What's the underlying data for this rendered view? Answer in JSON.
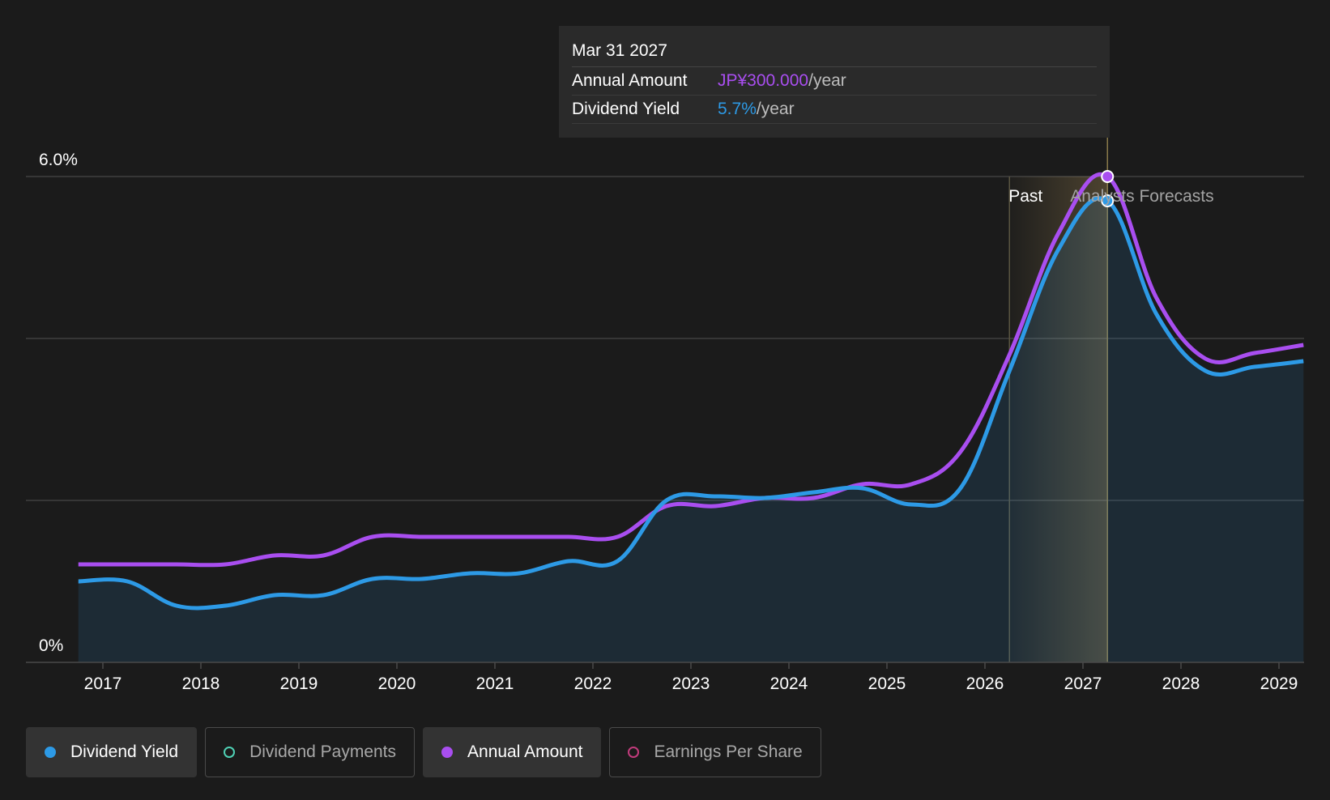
{
  "colors": {
    "background": "#1b1b1b",
    "dividend_yield": "#2d9ae6",
    "annual_amount": "#a94ef0",
    "dividend_payments": "#4fd1b5",
    "earnings_per_share": "#c23b7c",
    "gridline": "#3f3f3f"
  },
  "tooltip": {
    "date": "Mar 31 2027",
    "rows": [
      {
        "label": "Annual Amount",
        "value": "JP¥300.000",
        "unit": "/year",
        "color": "#a94ef0"
      },
      {
        "label": "Dividend Yield",
        "value": "5.7%",
        "unit": "/year",
        "color": "#2d9ae6"
      }
    ]
  },
  "regions": {
    "past_label": "Past",
    "forecast_label": "Analysts Forecasts",
    "past_end_x": 2026.25,
    "forecast_start_x": 2027.25
  },
  "legend": [
    {
      "label": "Dividend Yield",
      "color": "#2d9ae6",
      "active": true,
      "filled": true
    },
    {
      "label": "Dividend Payments",
      "color": "#4fd1b5",
      "active": false,
      "filled": false
    },
    {
      "label": "Annual Amount",
      "color": "#a94ef0",
      "active": true,
      "filled": true
    },
    {
      "label": "Earnings Per Share",
      "color": "#c23b7c",
      "active": false,
      "filled": false
    }
  ],
  "chart_data": {
    "type": "line",
    "title": "",
    "xlabel": "",
    "ylabel": "",
    "xlim": [
      2016.5,
      2029.25
    ],
    "ylim": [
      0,
      6.0
    ],
    "y_tick_labels": [
      "0%",
      "6.0%"
    ],
    "y_ticks": [
      0,
      6.0
    ],
    "y_gridlines": [
      2.0,
      4.0,
      6.0
    ],
    "x_ticks": [
      2017,
      2018,
      2019,
      2020,
      2021,
      2022,
      2023,
      2024,
      2025,
      2026,
      2027,
      2028,
      2029
    ],
    "x_tick_labels": [
      "2017",
      "2018",
      "2019",
      "2020",
      "2021",
      "2022",
      "2023",
      "2024",
      "2025",
      "2026",
      "2027",
      "2028",
      "2029"
    ],
    "grid": true,
    "legend_position": "bottom",
    "series": [
      {
        "name": "Dividend Yield",
        "points": [
          [
            2016.75,
            1.0
          ],
          [
            2017.25,
            1.0
          ],
          [
            2017.75,
            0.7
          ],
          [
            2018.25,
            0.7
          ],
          [
            2018.75,
            0.83
          ],
          [
            2019.25,
            0.83
          ],
          [
            2019.75,
            1.03
          ],
          [
            2020.25,
            1.03
          ],
          [
            2020.75,
            1.1
          ],
          [
            2021.25,
            1.1
          ],
          [
            2021.75,
            1.25
          ],
          [
            2022.25,
            1.25
          ],
          [
            2022.75,
            2.0
          ],
          [
            2023.25,
            2.05
          ],
          [
            2023.75,
            2.03
          ],
          [
            2024.25,
            2.1
          ],
          [
            2024.75,
            2.15
          ],
          [
            2025.25,
            1.95
          ],
          [
            2025.75,
            2.15
          ],
          [
            2026.25,
            3.6
          ],
          [
            2026.75,
            5.1
          ],
          [
            2027.25,
            5.7
          ],
          [
            2027.75,
            4.3
          ],
          [
            2028.25,
            3.6
          ],
          [
            2028.75,
            3.65
          ],
          [
            2029.25,
            3.72
          ]
        ]
      },
      {
        "name": "Annual Amount",
        "points": [
          [
            2016.75,
            1.21
          ],
          [
            2017.25,
            1.21
          ],
          [
            2017.75,
            1.21
          ],
          [
            2018.25,
            1.21
          ],
          [
            2018.75,
            1.32
          ],
          [
            2019.25,
            1.32
          ],
          [
            2019.75,
            1.55
          ],
          [
            2020.25,
            1.55
          ],
          [
            2020.75,
            1.55
          ],
          [
            2021.25,
            1.55
          ],
          [
            2021.75,
            1.55
          ],
          [
            2022.25,
            1.55
          ],
          [
            2022.75,
            1.93
          ],
          [
            2023.25,
            1.93
          ],
          [
            2023.75,
            2.03
          ],
          [
            2024.25,
            2.03
          ],
          [
            2024.75,
            2.2
          ],
          [
            2025.25,
            2.2
          ],
          [
            2025.75,
            2.6
          ],
          [
            2026.25,
            3.8
          ],
          [
            2026.75,
            5.3
          ],
          [
            2027.25,
            6.0
          ],
          [
            2027.75,
            4.5
          ],
          [
            2028.25,
            3.75
          ],
          [
            2028.75,
            3.82
          ],
          [
            2029.25,
            3.92
          ]
        ]
      }
    ],
    "highlight_x": 2027.25
  }
}
